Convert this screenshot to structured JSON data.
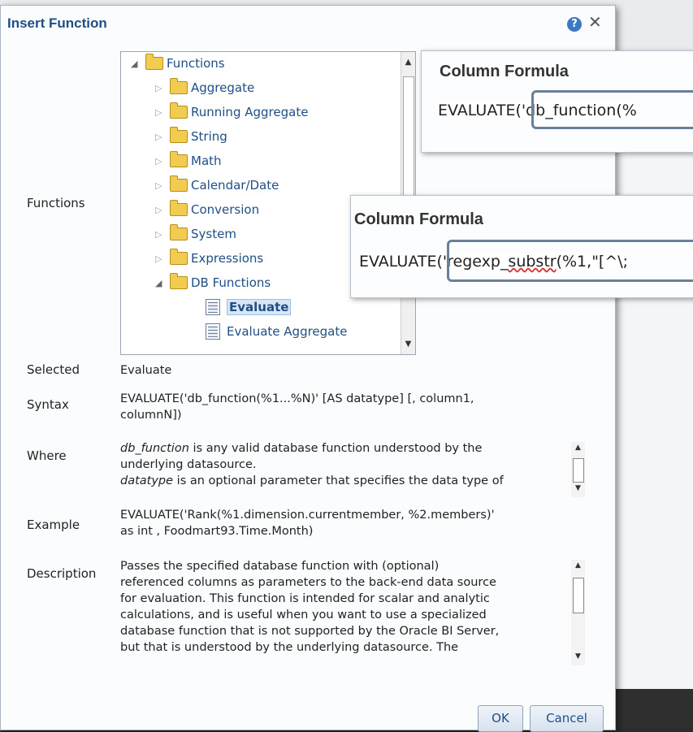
{
  "dialog": {
    "title": "Insert Function",
    "help_icon": "?",
    "close_icon": "✕"
  },
  "labels": {
    "functions": "Functions",
    "selected": "Selected",
    "syntax": "Syntax",
    "where": "Where",
    "example": "Example",
    "description": "Description"
  },
  "tree": {
    "root": "Functions",
    "items": [
      "Aggregate",
      "Running Aggregate",
      "String",
      "Math",
      "Calendar/Date",
      "Conversion",
      "System",
      "Expressions",
      "DB Functions"
    ],
    "leaves": [
      "Evaluate",
      "Evaluate Aggregate"
    ]
  },
  "details": {
    "selected": "Evaluate",
    "syntax_1": "EVALUATE('db_function(%1...%N)' [AS datatype] [, column1,",
    "syntax_2": "columnN])",
    "where_1_em": "db_function",
    "where_1_rest": " is any valid database function understood by the",
    "where_2": "underlying datasource.",
    "where_3_em": "datatype",
    "where_3_rest": " is an optional parameter that specifies the data type of",
    "example_1": "EVALUATE('Rank(%1.dimension.currentmember, %2.members)'",
    "example_2": "as int , Foodmart93.Time.Month)",
    "description_lines": [
      "Passes the specified database function with (optional)",
      "referenced columns as parameters to the back-end data source",
      "for evaluation. This function is intended for scalar and analytic",
      "calculations, and is useful when you want to use a specialized",
      "database function that is not supported by the Oracle BI Server,",
      "but that is understood by the underlying datasource. The"
    ]
  },
  "buttons": {
    "ok": "OK",
    "cancel": "Cancel"
  },
  "overlay1": {
    "title": "Column Formula",
    "formula_prefix": "EVALUAT",
    "formula_boxed": "E('db_function(%"
  },
  "overlay2": {
    "title": "Column Formula",
    "formula_prefix": "EVALUAT",
    "formula_boxed_a": "E('regexp_",
    "formula_boxed_b": "substr",
    "formula_boxed_c": "(%1,\"[^\\;"
  }
}
